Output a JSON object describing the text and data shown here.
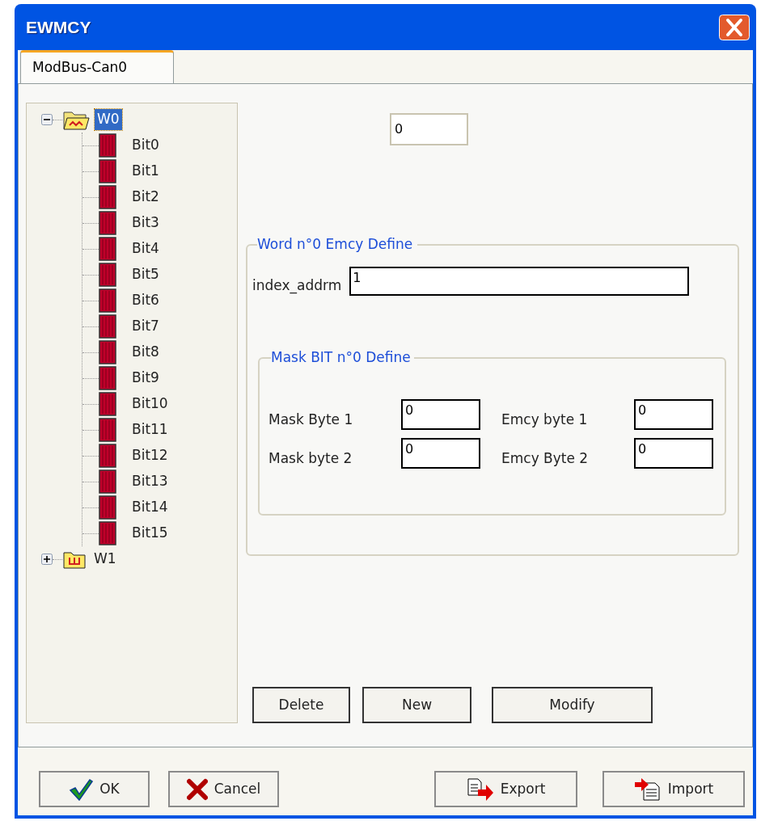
{
  "window": {
    "title": "EWMCY"
  },
  "tabs": [
    {
      "label": "ModBus-Can0",
      "selected": true
    }
  ],
  "tree": [
    {
      "label": "W0",
      "selected": true,
      "expanded": true,
      "children": [
        {
          "label": "Bit0",
          "selected": false
        },
        {
          "label": "Bit1",
          "selected": false
        },
        {
          "label": "Bit2",
          "selected": false
        },
        {
          "label": "Bit3",
          "selected": false
        },
        {
          "label": "Bit4",
          "selected": false
        },
        {
          "label": "Bit5",
          "selected": false
        },
        {
          "label": "Bit6",
          "selected": false
        },
        {
          "label": "Bit7",
          "selected": false
        },
        {
          "label": "Bit8",
          "selected": false
        },
        {
          "label": "Bit9",
          "selected": false
        },
        {
          "label": "Bit10",
          "selected": false
        },
        {
          "label": "Bit11",
          "selected": false
        },
        {
          "label": "Bit12",
          "selected": false
        },
        {
          "label": "Bit13",
          "selected": false
        },
        {
          "label": "Bit14",
          "selected": false
        },
        {
          "label": "Bit15",
          "selected": false
        }
      ]
    },
    {
      "label": "W1",
      "selected": false,
      "expanded": false
    }
  ],
  "top_field": {
    "value": "0"
  },
  "word_group": {
    "title": "Word n°0 Emcy Define",
    "index_label": "index_addrm",
    "index_value": "1",
    "mask_group": {
      "title": "Mask BIT n°0 Define",
      "fields": [
        {
          "label": "Mask Byte 1",
          "value": "0"
        },
        {
          "label": "Emcy byte 1",
          "value": "0"
        },
        {
          "label": "Mask byte 2",
          "value": "0"
        },
        {
          "label": "Emcy Byte 2",
          "value": "0"
        }
      ]
    }
  },
  "action_buttons": [
    "Delete",
    "New",
    "Modify"
  ],
  "dialog_buttons": [
    {
      "label": "OK",
      "kind": "ok"
    },
    {
      "label": "Cancel",
      "kind": "cancel"
    },
    {
      "label": "Export",
      "kind": "export"
    },
    {
      "label": "Import",
      "kind": "import"
    }
  ]
}
